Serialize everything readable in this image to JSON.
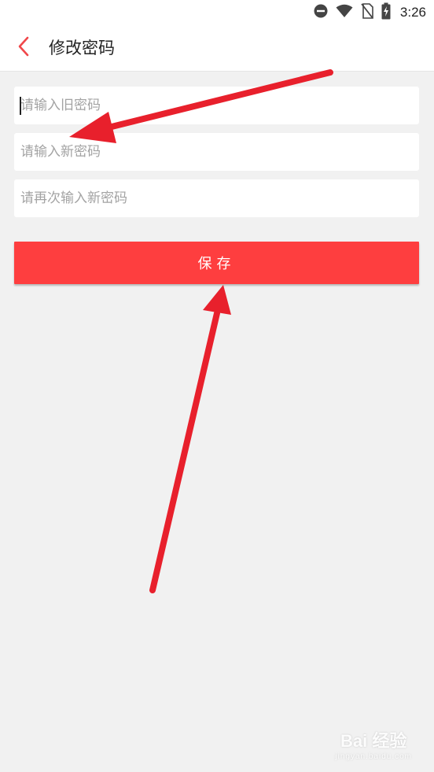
{
  "status_bar": {
    "time": "3:26",
    "icons": [
      "do-not-disturb-icon",
      "wifi-icon",
      "no-sim-icon",
      "battery-charging-icon"
    ]
  },
  "header": {
    "title": "修改密码",
    "back_icon": "chevron-left-icon"
  },
  "form": {
    "old_password": {
      "placeholder": "请输入旧密码",
      "value": ""
    },
    "new_password": {
      "placeholder": "请输入新密码",
      "value": ""
    },
    "confirm_password": {
      "placeholder": "请再次输入新密码",
      "value": ""
    },
    "save_label": "保存"
  },
  "watermark": {
    "logo": "Bai 经验",
    "sub": "jingyan.baidu.com"
  },
  "colors": {
    "accent": "#fe3e3f",
    "annotation": "#e8202c",
    "background": "#f1f1f1"
  }
}
